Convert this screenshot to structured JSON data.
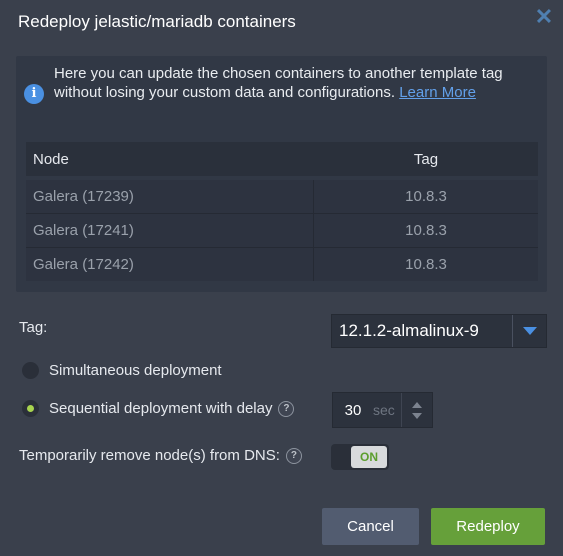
{
  "dialog": {
    "title": "Redeploy jelastic/mariadb containers",
    "close_icon": "close-icon"
  },
  "info": {
    "text": "Here you can update the chosen containers to another template tag without losing your custom data and configurations.",
    "link": "Learn More"
  },
  "table": {
    "headers": {
      "node": "Node",
      "tag": "Tag"
    },
    "rows": [
      {
        "node": "Galera (17239)",
        "tag": "10.8.3"
      },
      {
        "node": "Galera (17241)",
        "tag": "10.8.3"
      },
      {
        "node": "Galera (17242)",
        "tag": "10.8.3"
      }
    ]
  },
  "tag_select": {
    "label": "Tag:",
    "value": "12.1.2-almalinux-9"
  },
  "deployment": {
    "simultaneous_label": "Simultaneous deployment",
    "sequential_label": "Sequential deployment with delay",
    "selected": "sequential",
    "delay_value": "30",
    "delay_unit": "sec"
  },
  "dns": {
    "label": "Temporarily remove node(s) from DNS:",
    "toggle_state": "ON"
  },
  "buttons": {
    "cancel": "Cancel",
    "redeploy": "Redeploy"
  },
  "colors": {
    "accent": "#4a90e2",
    "success": "#66a03a",
    "background": "#3a404c"
  }
}
